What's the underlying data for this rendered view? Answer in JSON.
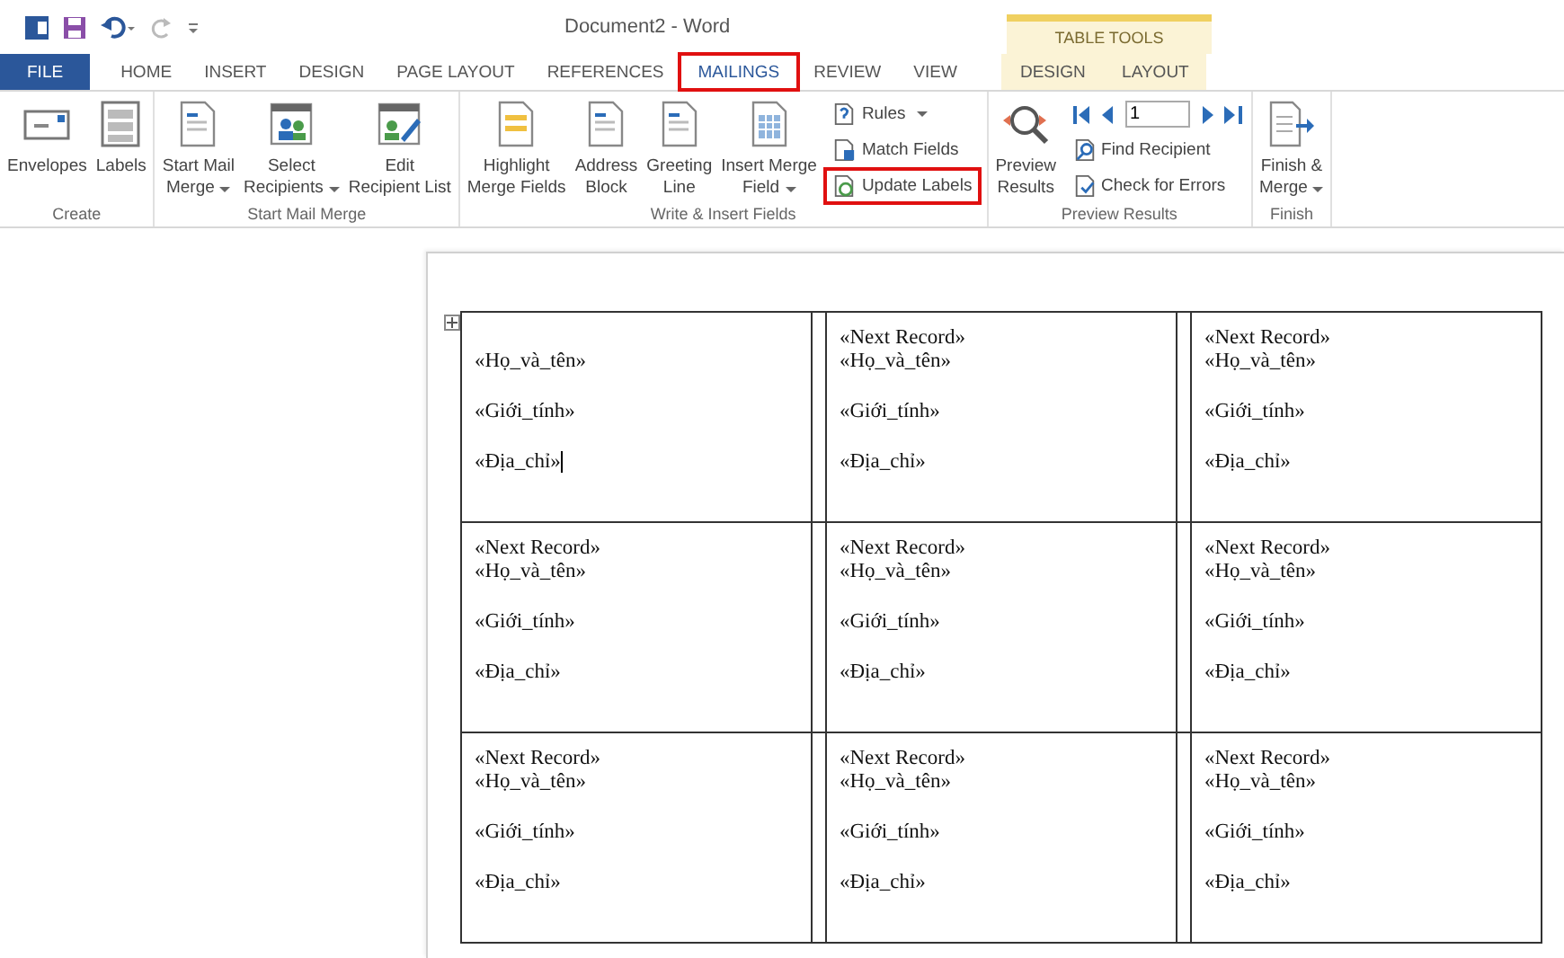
{
  "window": {
    "title": "Document2 - Word"
  },
  "tabs": [
    {
      "label": "FILE",
      "kind": "file",
      "selected": false,
      "highlighted": false
    },
    {
      "label": "HOME",
      "kind": "tab",
      "selected": false,
      "highlighted": false
    },
    {
      "label": "INSERT",
      "kind": "tab",
      "selected": false,
      "highlighted": false
    },
    {
      "label": "DESIGN",
      "kind": "tab",
      "selected": false,
      "highlighted": false
    },
    {
      "label": "PAGE LAYOUT",
      "kind": "tab",
      "selected": false,
      "highlighted": false
    },
    {
      "label": "REFERENCES",
      "kind": "tab",
      "selected": false,
      "highlighted": false
    },
    {
      "label": "MAILINGS",
      "kind": "tab",
      "selected": true,
      "highlighted": true
    },
    {
      "label": "REVIEW",
      "kind": "tab",
      "selected": false,
      "highlighted": false
    },
    {
      "label": "VIEW",
      "kind": "tab",
      "selected": false,
      "highlighted": false
    }
  ],
  "contextual_tabs": {
    "title": "TABLE TOOLS",
    "tabs": [
      {
        "label": "DESIGN",
        "selected": false
      },
      {
        "label": "LAYOUT",
        "selected": false
      }
    ]
  },
  "ribbon_groups": [
    {
      "label": "Create",
      "columns": [
        {
          "kind": "large",
          "lines": [
            "Envelopes"
          ],
          "dropdown": false,
          "highlighted": false
        },
        {
          "kind": "large",
          "lines": [
            "Labels"
          ],
          "dropdown": false,
          "highlighted": false
        }
      ]
    },
    {
      "label": "Start Mail Merge",
      "columns": [
        {
          "kind": "large",
          "lines": [
            "Start Mail",
            "Merge"
          ],
          "dropdown": true,
          "highlighted": false
        },
        {
          "kind": "large",
          "lines": [
            "Select",
            "Recipients"
          ],
          "dropdown": true,
          "highlighted": false
        },
        {
          "kind": "large",
          "lines": [
            "Edit",
            "Recipient List"
          ],
          "dropdown": false,
          "highlighted": false
        }
      ]
    },
    {
      "label": "Write & Insert Fields",
      "columns": [
        {
          "kind": "large",
          "lines": [
            "Highlight",
            "Merge Fields"
          ],
          "dropdown": false,
          "highlighted": false
        },
        {
          "kind": "large",
          "lines": [
            "Address",
            "Block"
          ],
          "dropdown": false,
          "highlighted": false
        },
        {
          "kind": "large",
          "lines": [
            "Greeting",
            "Line"
          ],
          "dropdown": false,
          "highlighted": false
        },
        {
          "kind": "large",
          "lines": [
            "Insert Merge",
            "Field"
          ],
          "dropdown": true,
          "highlighted": false
        },
        {
          "kind": "small-stack",
          "items": [
            {
              "label": "Rules",
              "dropdown": true,
              "highlighted": false
            },
            {
              "label": "Match Fields",
              "dropdown": false,
              "highlighted": false
            },
            {
              "label": "Update Labels",
              "dropdown": false,
              "highlighted": true
            }
          ]
        }
      ]
    },
    {
      "label": "Preview Results",
      "columns": [
        {
          "kind": "large",
          "lines": [
            "Preview",
            "Results"
          ],
          "dropdown": false,
          "highlighted": false
        },
        {
          "kind": "record-nav",
          "record": "1",
          "items": [
            {
              "label": "Find Recipient",
              "dropdown": false,
              "highlighted": false
            },
            {
              "label": "Check for Errors",
              "dropdown": false,
              "highlighted": false
            }
          ]
        }
      ]
    },
    {
      "label": "Finish",
      "columns": [
        {
          "kind": "large",
          "lines": [
            "Finish &",
            "Merge"
          ],
          "dropdown": true,
          "highlighted": false
        }
      ]
    }
  ],
  "label_rows": [
    [
      {
        "lines": [
          "«Họ_và_tên»",
          "«Giới_tính»",
          "«Địa_chỉ»"
        ],
        "cursor": true
      },
      {
        "next_record": "«Next Record»",
        "lines": [
          "«Họ_và_tên»",
          "«Giới_tính»",
          "«Địa_chỉ»"
        ],
        "cursor": false
      },
      {
        "next_record": "«Next Record»",
        "lines": [
          "«Họ_và_tên»",
          "«Giới_tính»",
          "«Địa_chỉ»"
        ],
        "cursor": false
      }
    ],
    [
      {
        "next_record": "«Next Record»",
        "lines": [
          "«Họ_và_tên»",
          "«Giới_tính»",
          "«Địa_chỉ»"
        ],
        "cursor": false
      },
      {
        "next_record": "«Next Record»",
        "lines": [
          "«Họ_và_tên»",
          "«Giới_tính»",
          "«Địa_chỉ»"
        ],
        "cursor": false
      },
      {
        "next_record": "«Next Record»",
        "lines": [
          "«Họ_và_tên»",
          "«Giới_tính»",
          "«Địa_chỉ»"
        ],
        "cursor": false
      }
    ],
    [
      {
        "next_record": "«Next Record»",
        "lines": [
          "«Họ_và_tên»",
          "«Giới_tính»",
          "«Địa_chỉ»"
        ],
        "cursor": false
      },
      {
        "next_record": "«Next Record»",
        "lines": [
          "«Họ_và_tên»",
          "«Giới_tính»",
          "«Địa_chỉ»"
        ],
        "cursor": false
      },
      {
        "next_record": "«Next Record»",
        "lines": [
          "«Họ_và_tên»",
          "«Giới_tính»",
          "«Địa_chỉ»"
        ],
        "cursor": false
      }
    ]
  ]
}
